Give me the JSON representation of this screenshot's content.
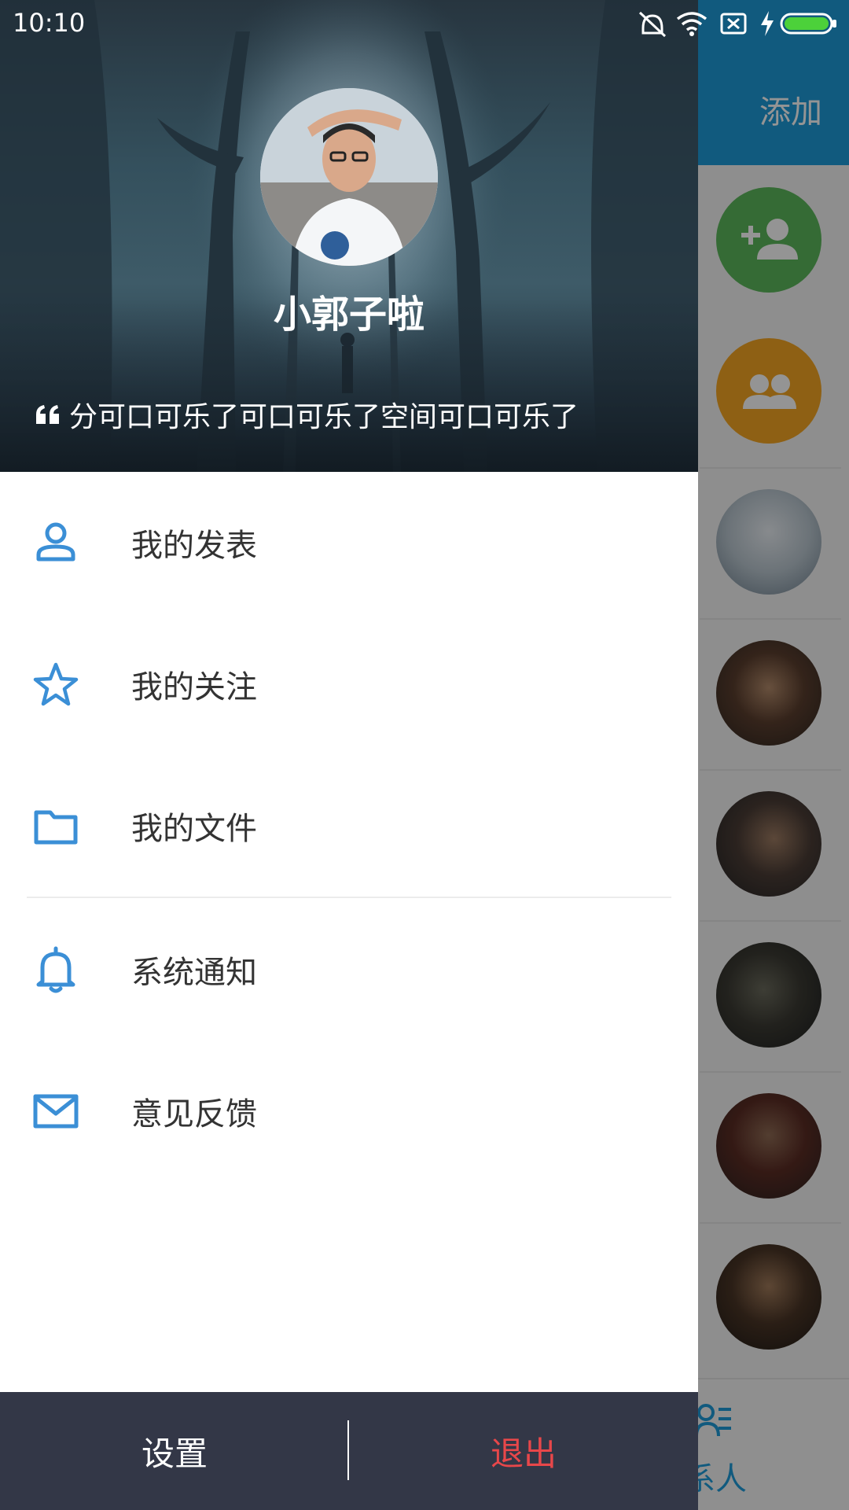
{
  "status_bar": {
    "time": "10:10"
  },
  "background_app": {
    "header_action": "添加",
    "bottom_tab_label": "系人"
  },
  "drawer": {
    "username": "小郭子啦",
    "signature": "分可口可乐了可口可乐了空间可口可乐了",
    "menu_items": [
      {
        "label": "我的发表",
        "icon": "person-icon"
      },
      {
        "label": "我的关注",
        "icon": "star-icon"
      },
      {
        "label": "我的文件",
        "icon": "folder-icon"
      },
      {
        "label": "系统通知",
        "icon": "bell-icon"
      },
      {
        "label": "意见反馈",
        "icon": "mail-icon"
      }
    ],
    "settings_label": "设置",
    "logout_label": "退出"
  },
  "colors": {
    "accent": "#3b8fd6",
    "logout": "#e8474a",
    "bottom_bar": "#333747"
  }
}
